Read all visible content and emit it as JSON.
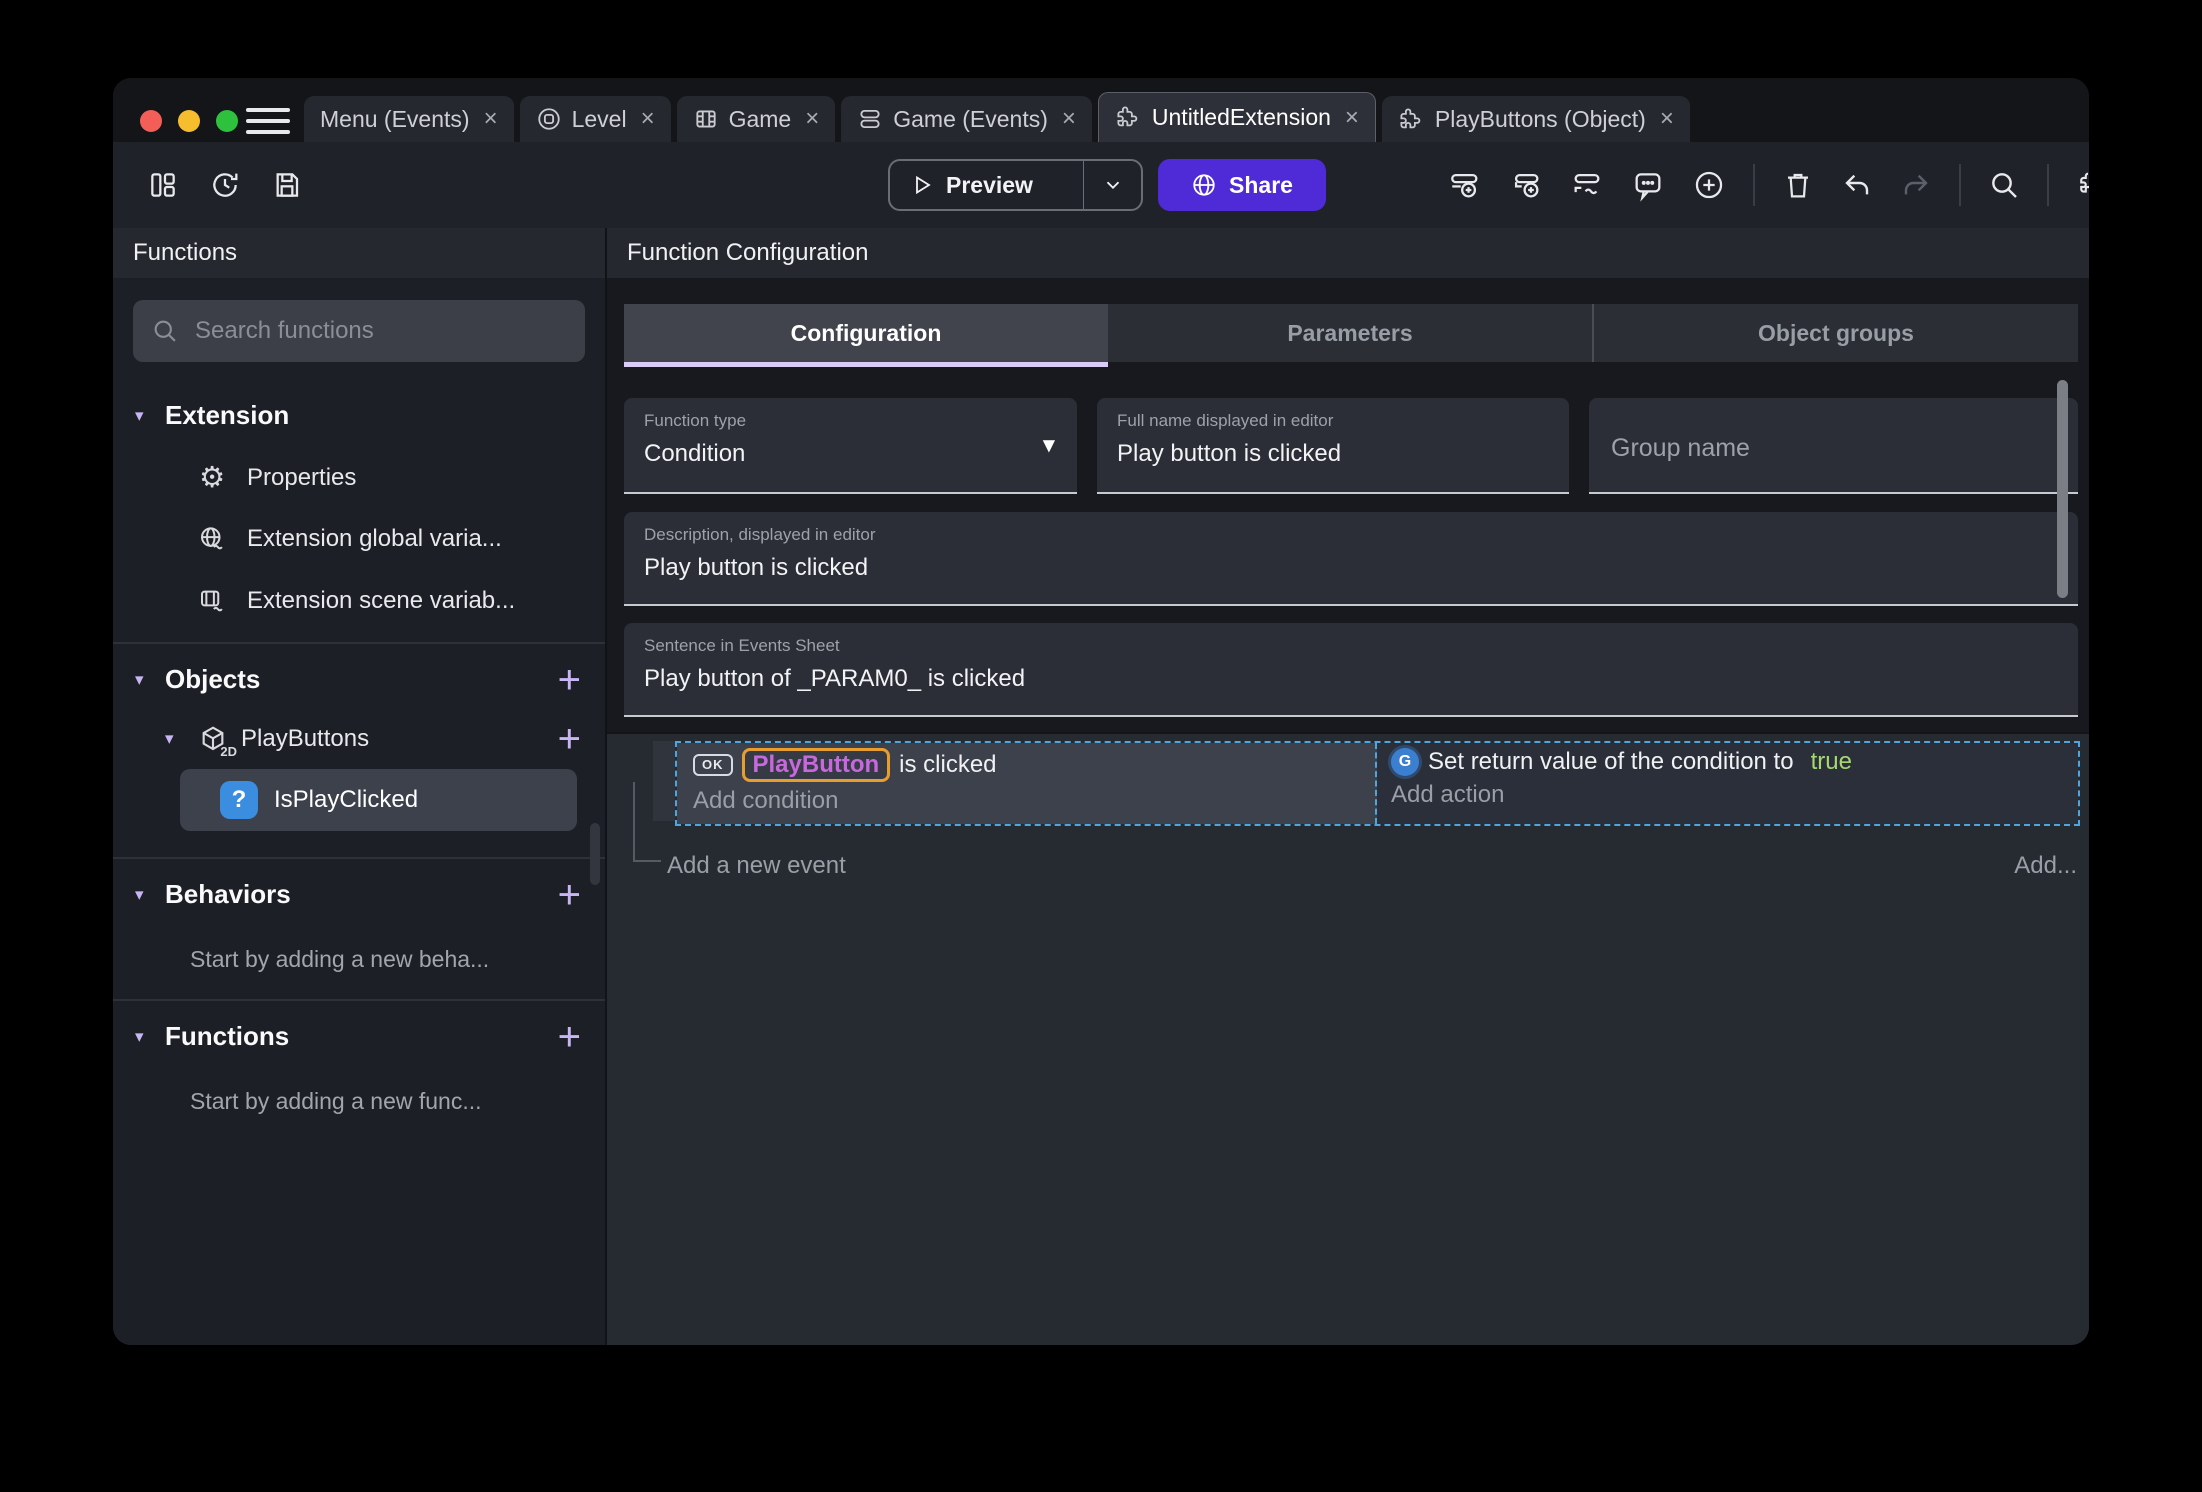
{
  "window": {
    "traffic_lights": {
      "close": "#f35f58",
      "minimize": "#f6bd2f",
      "zoom": "#2ec13d"
    },
    "tabs": [
      {
        "label": "Menu (Events)"
      },
      {
        "label": "Level"
      },
      {
        "label": "Game"
      },
      {
        "label": "Game (Events)"
      },
      {
        "label": "UntitledExtension"
      },
      {
        "label": "PlayButtons (Object)"
      }
    ],
    "toolbar": {
      "preview_label": "Preview",
      "share_label": "Share"
    }
  },
  "sidebar": {
    "title": "Functions",
    "search_placeholder": "Search functions",
    "extension_section": {
      "label": "Extension",
      "items": [
        {
          "label": "Properties"
        },
        {
          "label": "Extension global varia..."
        },
        {
          "label": "Extension scene variab..."
        }
      ]
    },
    "objects_section": {
      "label": "Objects",
      "object": {
        "label": "PlayButtons",
        "badge": "2D"
      },
      "function": {
        "label": "IsPlayClicked",
        "badge": "?"
      }
    },
    "behaviors_section": {
      "label": "Behaviors",
      "hint": "Start by adding a new beha..."
    },
    "functions_section": {
      "label": "Functions",
      "hint": "Start by adding a new func..."
    }
  },
  "main": {
    "title": "Function Configuration",
    "tabs": [
      {
        "label": "Configuration"
      },
      {
        "label": "Parameters"
      },
      {
        "label": "Object groups"
      }
    ],
    "fields": {
      "function_type": {
        "label": "Function type",
        "value": "Condition"
      },
      "full_name": {
        "label": "Full name displayed in editor",
        "value": "Play button is clicked"
      },
      "group_name": {
        "placeholder": "Group name"
      },
      "description": {
        "label": "Description, displayed in editor",
        "value": "Play button is clicked"
      },
      "sentence": {
        "label": "Sentence in Events Sheet",
        "value": "Play button of _PARAM0_ is clicked"
      }
    },
    "events": {
      "condition": {
        "object_icon_label": "OK",
        "object_name": "PlayButton",
        "suffix": "is clicked",
        "add_label": "Add condition"
      },
      "action": {
        "icon_label": "G",
        "prefix": "Set return value of the condition to",
        "value": "true",
        "add_label": "Add action"
      },
      "add_event_label": "Add a new event",
      "add_more_label": "Add..."
    }
  },
  "icons": {
    "close": "×",
    "caret": "▾",
    "plus": "+",
    "dropdown": "▼",
    "gear": "⚙"
  },
  "colors": {
    "accent_purple": "#4f2bd8",
    "object_text_purple": "#c868dd",
    "selection_orange": "#e89e2f",
    "true_green": "#a6d870",
    "selection_blue_dashed": "#4da6e0",
    "lavender_accent": "#c7b6f3",
    "function_badge_blue": "#3b8de0"
  }
}
